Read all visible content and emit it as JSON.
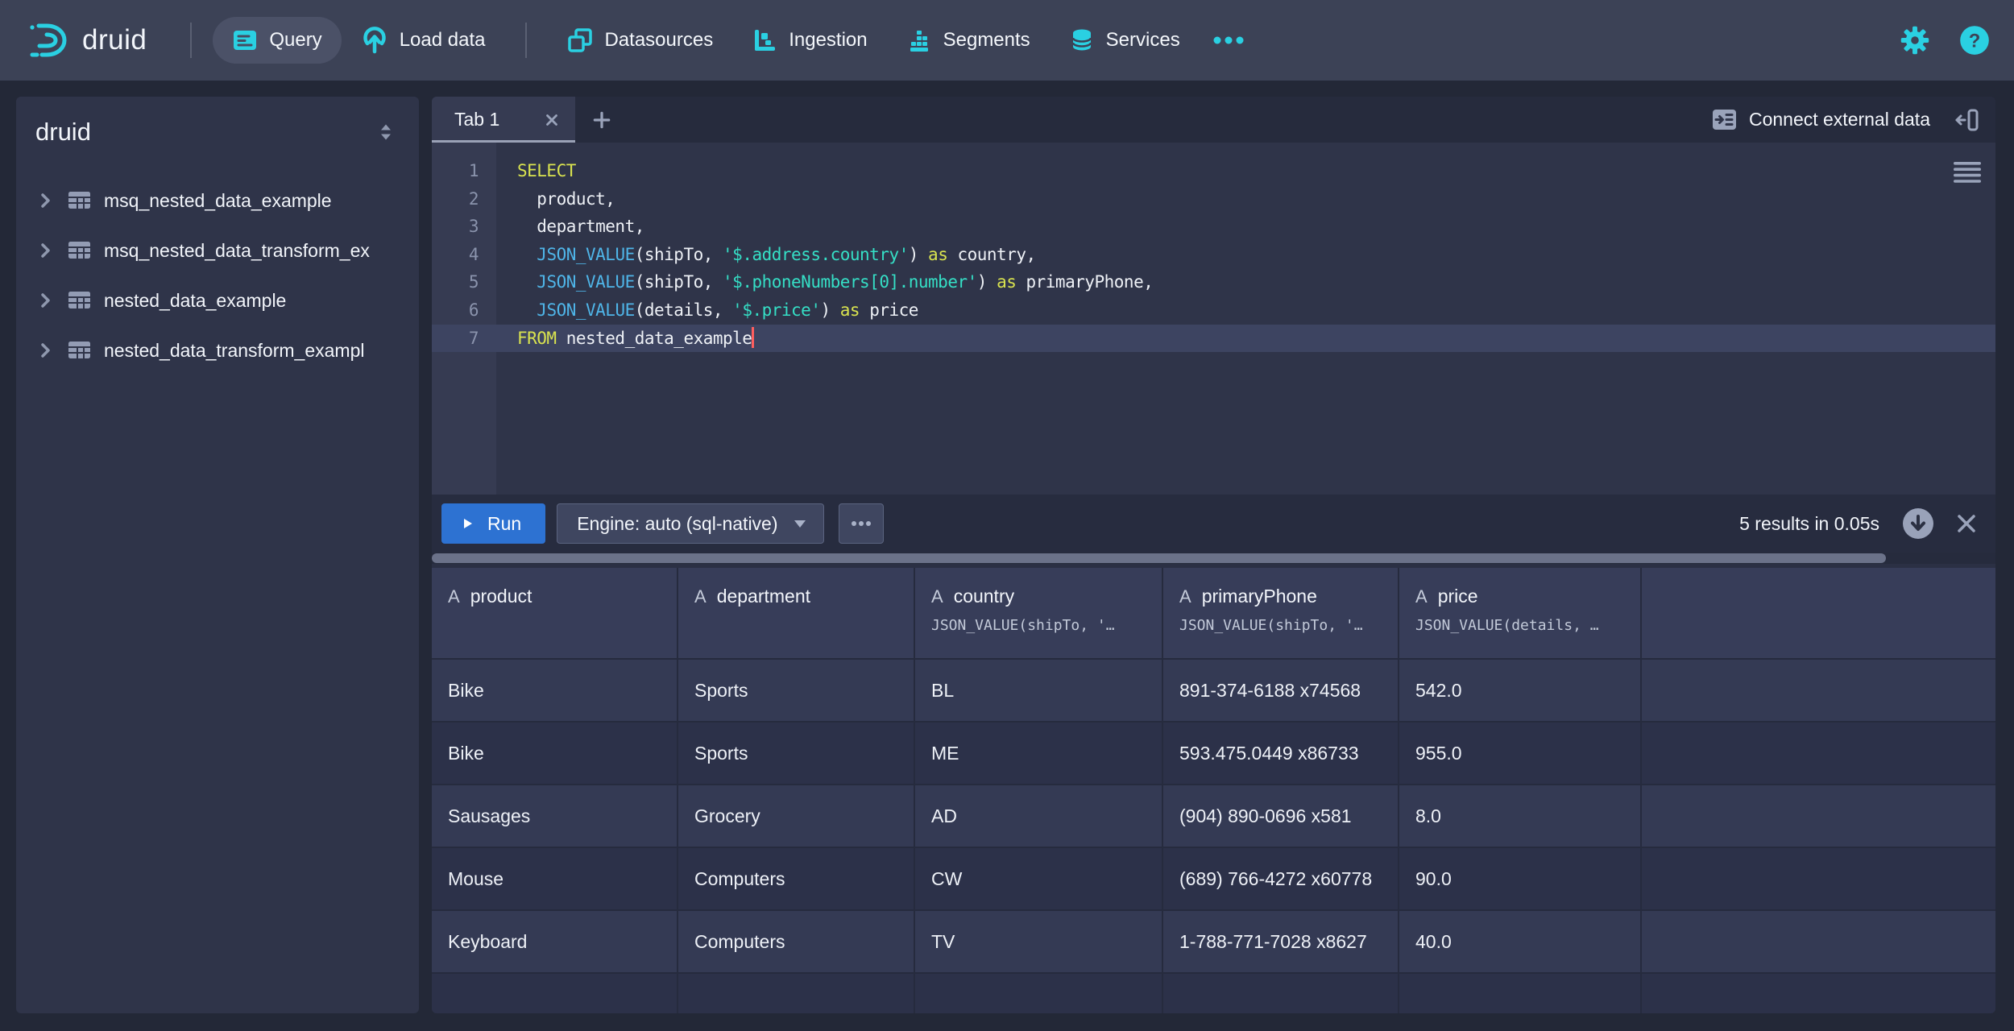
{
  "navbar": {
    "brand": "druid",
    "items": [
      {
        "label": "Query"
      },
      {
        "label": "Load data"
      },
      {
        "label": "Datasources"
      },
      {
        "label": "Ingestion"
      },
      {
        "label": "Segments"
      },
      {
        "label": "Services"
      }
    ]
  },
  "sidebar": {
    "title": "druid",
    "tables": [
      "msq_nested_data_example",
      "msq_nested_data_transform_ex",
      "nested_data_example",
      "nested_data_transform_exampl"
    ]
  },
  "tabs": {
    "items": [
      {
        "label": "Tab 1"
      }
    ]
  },
  "tabbar": {
    "connect_label": "Connect external data"
  },
  "editor": {
    "lines": [
      {
        "num": "1",
        "tokens": [
          [
            "kw",
            "SELECT"
          ]
        ]
      },
      {
        "num": "2",
        "tokens": [
          [
            "pln",
            "  product,"
          ]
        ]
      },
      {
        "num": "3",
        "tokens": [
          [
            "pln",
            "  department,"
          ]
        ]
      },
      {
        "num": "4",
        "tokens": [
          [
            "pln",
            "  "
          ],
          [
            "fn",
            "JSON_VALUE"
          ],
          [
            "pln",
            "(shipTo, "
          ],
          [
            "str",
            "'$.address.country'"
          ],
          [
            "pln",
            ") "
          ],
          [
            "kw",
            "as"
          ],
          [
            "pln",
            " country,"
          ]
        ]
      },
      {
        "num": "5",
        "tokens": [
          [
            "pln",
            "  "
          ],
          [
            "fn",
            "JSON_VALUE"
          ],
          [
            "pln",
            "(shipTo, "
          ],
          [
            "str",
            "'$.phoneNumbers[0].number'"
          ],
          [
            "pln",
            ") "
          ],
          [
            "kw",
            "as"
          ],
          [
            "pln",
            " primaryPhone,"
          ]
        ]
      },
      {
        "num": "6",
        "tokens": [
          [
            "pln",
            "  "
          ],
          [
            "fn",
            "JSON_VALUE"
          ],
          [
            "pln",
            "(details, "
          ],
          [
            "str",
            "'$.price'"
          ],
          [
            "pln",
            ") "
          ],
          [
            "kw",
            "as"
          ],
          [
            "pln",
            " price"
          ]
        ]
      },
      {
        "num": "7",
        "active": true,
        "cursor": true,
        "tokens": [
          [
            "kw",
            "FROM"
          ],
          [
            "pln",
            " nested_data_example"
          ]
        ]
      }
    ]
  },
  "runbar": {
    "run_label": "Run",
    "engine_label": "Engine: auto (sql-native)",
    "status": "5 results in 0.05s"
  },
  "results": {
    "type_glyph": "A",
    "columns": [
      {
        "name": "product",
        "formula": ""
      },
      {
        "name": "department",
        "formula": ""
      },
      {
        "name": "country",
        "formula": "JSON_VALUE(shipTo, '…"
      },
      {
        "name": "primaryPhone",
        "formula": "JSON_VALUE(shipTo, '…"
      },
      {
        "name": "price",
        "formula": "JSON_VALUE(details, …"
      }
    ],
    "rows": [
      [
        "Bike",
        "Sports",
        "BL",
        "891-374-6188 x74568",
        "542.0"
      ],
      [
        "Bike",
        "Sports",
        "ME",
        "593.475.0449 x86733",
        "955.0"
      ],
      [
        "Sausages",
        "Grocery",
        "AD",
        "(904) 890-0696 x581",
        "8.0"
      ],
      [
        "Mouse",
        "Computers",
        "CW",
        "(689) 766-4272 x60778",
        "90.0"
      ],
      [
        "Keyboard",
        "Computers",
        "TV",
        "1-788-771-7028 x8627",
        "40.0"
      ]
    ]
  }
}
